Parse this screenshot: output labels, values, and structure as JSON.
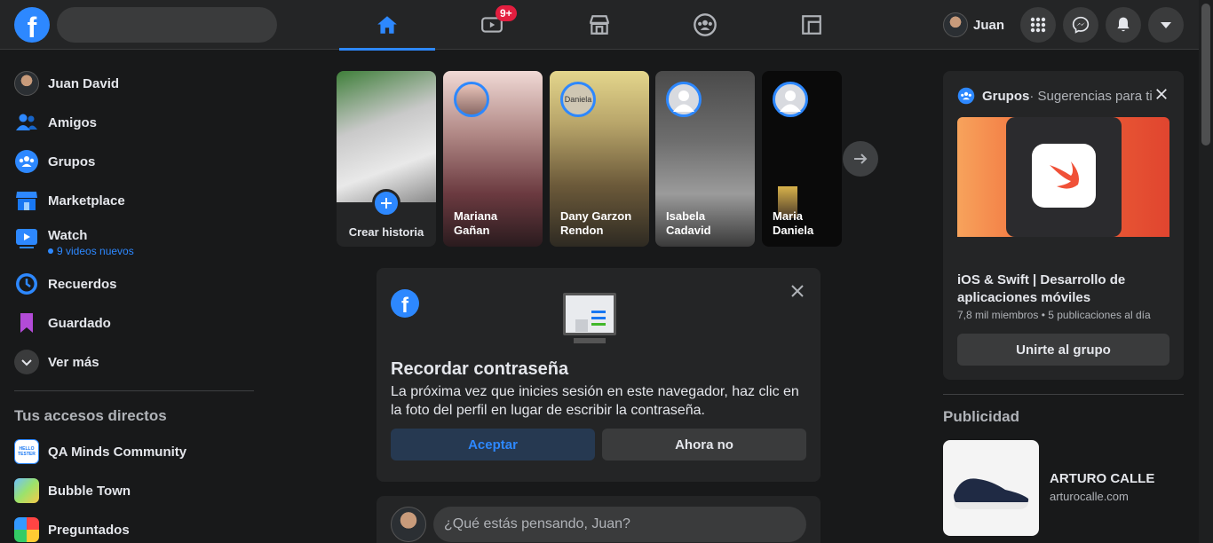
{
  "topbar": {
    "logo_letter": "f",
    "watch_badge": "9+",
    "profile_name": "Juan"
  },
  "sidebar": {
    "items": [
      {
        "label": "Juan David"
      },
      {
        "label": "Amigos"
      },
      {
        "label": "Grupos"
      },
      {
        "label": "Marketplace"
      },
      {
        "label": "Watch",
        "sub": "9 videos nuevos"
      },
      {
        "label": "Recuerdos"
      },
      {
        "label": "Guardado"
      },
      {
        "label": "Ver más"
      }
    ],
    "shortcuts_title": "Tus accesos directos",
    "shortcuts": [
      {
        "label": "QA Minds Community",
        "thumb_text": "HELLO TESTER"
      },
      {
        "label": "Bubble Town"
      },
      {
        "label": "Preguntados"
      }
    ]
  },
  "stories": [
    {
      "name": "Crear historia"
    },
    {
      "name": "Mariana Gañan"
    },
    {
      "name": "Dany Garzon Rendon",
      "ring_text": "Daniela"
    },
    {
      "name": "Isabela Cadavid"
    },
    {
      "name": "Maria Daniela"
    }
  ],
  "password_card": {
    "logo_letter": "f",
    "title": "Recordar contraseña",
    "text": "La próxima vez que inicies sesión en este navegador, haz clic en la foto del perfil en lugar de escribir la contraseña.",
    "accept": "Aceptar",
    "decline": "Ahora no"
  },
  "composer": {
    "placeholder": "¿Qué estás pensando, Juan?"
  },
  "groups_card": {
    "title": "Grupos",
    "subtitle": " · Sugerencias para ti",
    "group_name": "iOS & Swift | Desarrollo de aplicaciones móviles",
    "meta": "7,8 mil miembros • 5 publicaciones al día",
    "join": "Unirte al grupo"
  },
  "ads": {
    "title": "Publicidad",
    "brand": "ARTURO CALLE",
    "url": "arturocalle.com"
  },
  "colors": {
    "accent": "#2d88ff",
    "background": "#18191a",
    "surface": "#242526",
    "badge": "#e41e3f"
  }
}
